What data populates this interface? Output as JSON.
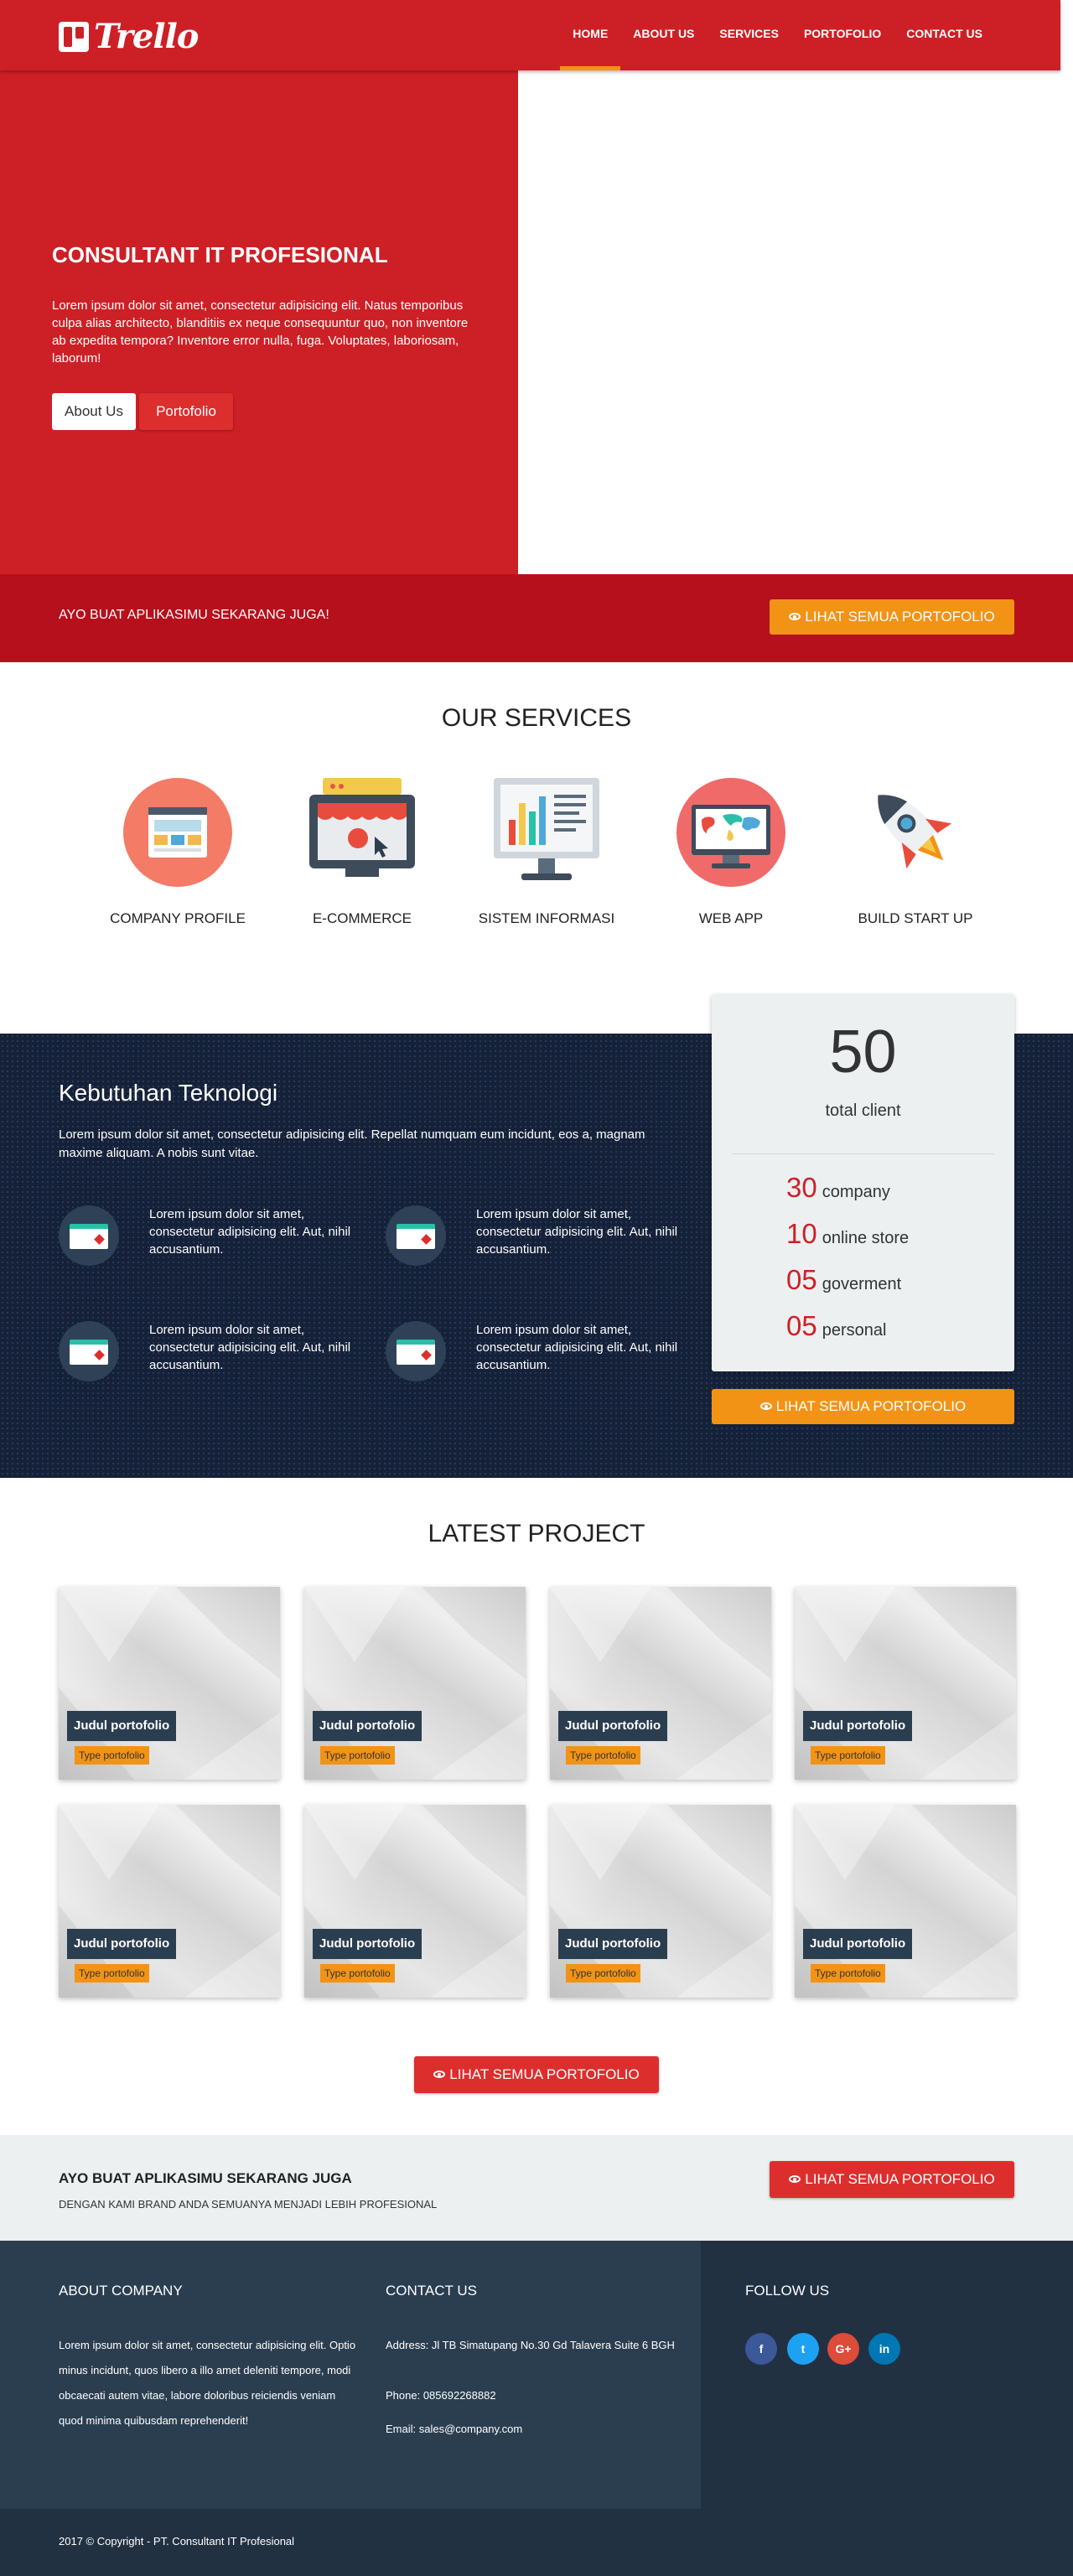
{
  "nav": {
    "brand": "Trello",
    "items": [
      "HOME",
      "ABOUT US",
      "SERVICES",
      "PORTOFOLIO",
      "CONTACT US"
    ],
    "active": "HOME"
  },
  "hero": {
    "title": "CONSULTANT IT PROFESIONAL",
    "text": "Lorem ipsum dolor sit amet, consectetur adipisicing elit. Natus temporibus culpa alias architecto, blanditiis ex neque consequuntur quo, non inventore ab expedita tempora? Inventore error nulla, fuga. Voluptates, laboriosam, laborum!",
    "btn_about": "About Us",
    "btn_portfolio": "Portofolio"
  },
  "cta": {
    "text": "AYO BUAT APLIKASIMU SEKARANG JUGA!",
    "button": "LIHAT SEMUA PORTOFOLIO"
  },
  "services": {
    "title": "OUR SERVICES",
    "items": [
      {
        "label": "COMPANY PROFILE",
        "icon": "company-profile-icon"
      },
      {
        "label": "E-COMMERCE",
        "icon": "ecommerce-store-icon"
      },
      {
        "label": "SISTEM INFORMASI",
        "icon": "information-system-icon"
      },
      {
        "label": "WEB APP",
        "icon": "web-app-icon"
      },
      {
        "label": "BUILD START UP",
        "icon": "rocket-icon"
      }
    ]
  },
  "tech": {
    "title": "Kebutuhan Teknologi",
    "text": "Lorem ipsum dolor sit amet, consectetur adipisicing elit. Repellat numquam eum incidunt, eos a, magnam maxime aliquam. A nobis sunt vitae.",
    "features": [
      "Lorem ipsum dolor sit amet, consectetur adipisicing elit. Aut, nihil accusantium.",
      "Lorem ipsum dolor sit amet, consectetur adipisicing elit. Aut, nihil accusantium.",
      "Lorem ipsum dolor sit amet, consectetur adipisicing elit. Aut, nihil accusantium.",
      "Lorem ipsum dolor sit amet, consectetur adipisicing elit. Aut, nihil accusantium."
    ],
    "button": "LIHAT SEMUA PORTOFOLIO"
  },
  "stats": {
    "total": "50",
    "total_label": "total client",
    "rows": [
      {
        "n": "30",
        "label": "company"
      },
      {
        "n": "10",
        "label": "online store"
      },
      {
        "n": "05",
        "label": "goverment"
      },
      {
        "n": "05",
        "label": "personal"
      }
    ]
  },
  "projects": {
    "title": "LATEST PROJECT",
    "items": [
      {
        "name": "Judul portofolio",
        "type": "Type portofolio"
      },
      {
        "name": "Judul portofolio",
        "type": "Type portofolio"
      },
      {
        "name": "Judul portofolio",
        "type": "Type portofolio"
      },
      {
        "name": "Judul portofolio",
        "type": "Type portofolio"
      },
      {
        "name": "Judul portofolio",
        "type": "Type portofolio"
      },
      {
        "name": "Judul portofolio",
        "type": "Type portofolio"
      },
      {
        "name": "Judul portofolio",
        "type": "Type portofolio"
      },
      {
        "name": "Judul portofolio",
        "type": "Type portofolio"
      }
    ],
    "button": "LIHAT SEMUA PORTOFOLIO"
  },
  "cta2": {
    "title": "AYO BUAT APLIKASIMU SEKARANG JUGA",
    "subtitle": "DENGAN KAMI BRAND ANDA SEMUANYA MENJADI LEBIH PROFESIONAL",
    "button": "LIHAT SEMUA PORTOFOLIO"
  },
  "footer": {
    "about_title": "ABOUT COMPANY",
    "about_text": "Lorem ipsum dolor sit amet, consectetur adipisicing elit. Optio minus incidunt, quos libero a illo amet deleniti tempore, modi obcaecati autem vitae, labore doloribus reiciendis veniam quod minima quibusdam reprehenderit!",
    "contact_title": "CONTACT US",
    "address": "Address: Jl TB Simatupang No.30 Gd Talavera Suite 6 BGH",
    "phone": "Phone: 085692268882",
    "email": "Email: sales@company.com",
    "follow_title": "FOLLOW US",
    "social": [
      {
        "label": "f",
        "icon": "facebook-icon",
        "color": "#3b5998"
      },
      {
        "label": "t",
        "icon": "twitter-icon",
        "color": "#1da1f2"
      },
      {
        "label": "G+",
        "icon": "google-plus-icon",
        "color": "#dd4b39"
      },
      {
        "label": "in",
        "icon": "linkedin-icon",
        "color": "#0077b5"
      }
    ],
    "copyright": "2017 © Copyright - PT. Consultant IT Profesional"
  },
  "colors": {
    "brand_red": "#cd2026",
    "cta_red": "#b5101b",
    "orange": "#f29316",
    "navy": "#152138",
    "footer": "#2b3e50"
  }
}
